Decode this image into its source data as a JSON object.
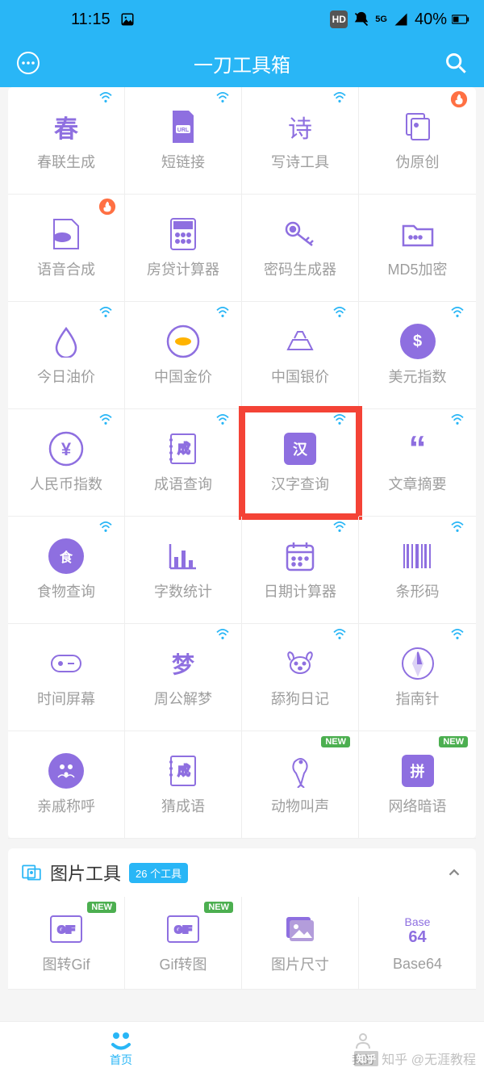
{
  "status": {
    "time": "11:15",
    "battery": "40%",
    "net": "5G",
    "hd": "HD"
  },
  "app": {
    "title": "一刀工具箱"
  },
  "tools": [
    {
      "label": "春联生成",
      "wifi": true,
      "hot": false,
      "new": false,
      "icon": "chun",
      "style": "text",
      "fg": "#8e6fe0"
    },
    {
      "label": "短链接",
      "wifi": true,
      "hot": false,
      "new": false,
      "icon": "url",
      "style": "doc",
      "fg": "#8e6fe0"
    },
    {
      "label": "写诗工具",
      "wifi": true,
      "hot": false,
      "new": false,
      "icon": "shi",
      "style": "text",
      "fg": "#8e6fe0"
    },
    {
      "label": "伪原创",
      "wifi": false,
      "hot": true,
      "new": false,
      "icon": "copy",
      "style": "outline",
      "fg": "#8e6fe0"
    },
    {
      "label": "语音合成",
      "wifi": false,
      "hot": true,
      "new": false,
      "icon": "mp3",
      "style": "outline",
      "fg": "#8e6fe0"
    },
    {
      "label": "房贷计算器",
      "wifi": false,
      "hot": false,
      "new": false,
      "icon": "calc",
      "style": "outline",
      "fg": "#8e6fe0"
    },
    {
      "label": "密码生成器",
      "wifi": false,
      "hot": false,
      "new": false,
      "icon": "key",
      "style": "outline",
      "fg": "#8e6fe0"
    },
    {
      "label": "MD5加密",
      "wifi": false,
      "hot": false,
      "new": false,
      "icon": "folder",
      "style": "outline",
      "fg": "#8e6fe0"
    },
    {
      "label": "今日油价",
      "wifi": true,
      "hot": false,
      "new": false,
      "icon": "drop",
      "style": "outline",
      "fg": "#8e6fe0"
    },
    {
      "label": "中国金价",
      "wifi": true,
      "hot": false,
      "new": false,
      "icon": "gold",
      "style": "circ-out",
      "fg": "#8e6fe0"
    },
    {
      "label": "中国银价",
      "wifi": true,
      "hot": false,
      "new": false,
      "icon": "silver",
      "style": "outline",
      "fg": "#8e6fe0"
    },
    {
      "label": "美元指数",
      "wifi": true,
      "hot": false,
      "new": false,
      "icon": "dollar",
      "style": "circ-fill",
      "fg": "#8e6fe0"
    },
    {
      "label": "人民币指数",
      "wifi": true,
      "hot": false,
      "new": false,
      "icon": "yen",
      "style": "circ-out",
      "fg": "#8e6fe0"
    },
    {
      "label": "成语查询",
      "wifi": true,
      "hot": false,
      "new": false,
      "icon": "cheng",
      "style": "book",
      "fg": "#8e6fe0"
    },
    {
      "label": "汉字查询",
      "wifi": true,
      "hot": false,
      "new": false,
      "icon": "han",
      "style": "sq-fill",
      "fg": "#8e6fe0",
      "highlight": true
    },
    {
      "label": "文章摘要",
      "wifi": true,
      "hot": false,
      "new": false,
      "icon": "quote",
      "style": "quote",
      "fg": "#8e6fe0"
    },
    {
      "label": "食物查询",
      "wifi": true,
      "hot": false,
      "new": false,
      "icon": "food",
      "style": "circ-fill",
      "fg": "#8e6fe0"
    },
    {
      "label": "字数统计",
      "wifi": false,
      "hot": false,
      "new": false,
      "icon": "chart",
      "style": "outline",
      "fg": "#8e6fe0"
    },
    {
      "label": "日期计算器",
      "wifi": true,
      "hot": false,
      "new": false,
      "icon": "cal",
      "style": "outline",
      "fg": "#8e6fe0"
    },
    {
      "label": "条形码",
      "wifi": true,
      "hot": false,
      "new": false,
      "icon": "barcode",
      "style": "outline",
      "fg": "#8e6fe0"
    },
    {
      "label": "时间屏幕",
      "wifi": false,
      "hot": false,
      "new": false,
      "icon": "clock",
      "style": "outline",
      "fg": "#8e6fe0"
    },
    {
      "label": "周公解梦",
      "wifi": true,
      "hot": false,
      "new": false,
      "icon": "meng",
      "style": "text",
      "fg": "#8e6fe0"
    },
    {
      "label": "舔狗日记",
      "wifi": true,
      "hot": false,
      "new": false,
      "icon": "dog",
      "style": "outline",
      "fg": "#8e6fe0"
    },
    {
      "label": "指南针",
      "wifi": true,
      "hot": false,
      "new": false,
      "icon": "compass",
      "style": "circ-out",
      "fg": "#8e6fe0"
    },
    {
      "label": "亲戚称呼",
      "wifi": false,
      "hot": false,
      "new": false,
      "icon": "family",
      "style": "circ-fill",
      "fg": "#8e6fe0"
    },
    {
      "label": "猜成语",
      "wifi": false,
      "hot": false,
      "new": false,
      "icon": "guess",
      "style": "book",
      "fg": "#8e6fe0"
    },
    {
      "label": "动物叫声",
      "wifi": false,
      "hot": false,
      "new": true,
      "icon": "bird",
      "style": "outline",
      "fg": "#8e6fe0"
    },
    {
      "label": "网络暗语",
      "wifi": false,
      "hot": false,
      "new": true,
      "icon": "pin",
      "style": "sq-fill",
      "fg": "#8e6fe0"
    }
  ],
  "section2": {
    "title": "图片工具",
    "count": "26 个工具"
  },
  "tools2": [
    {
      "label": "图转Gif",
      "new": true,
      "icon": "gif"
    },
    {
      "label": "Gif转图",
      "new": true,
      "icon": "gif"
    },
    {
      "label": "图片尺寸",
      "new": false,
      "icon": "img"
    },
    {
      "label": "Base64",
      "new": false,
      "icon": "b64"
    }
  ],
  "nav": {
    "home": "首页",
    "mine": "我的"
  },
  "badges": {
    "new": "NEW"
  },
  "watermark": "知乎 @无涯教程"
}
